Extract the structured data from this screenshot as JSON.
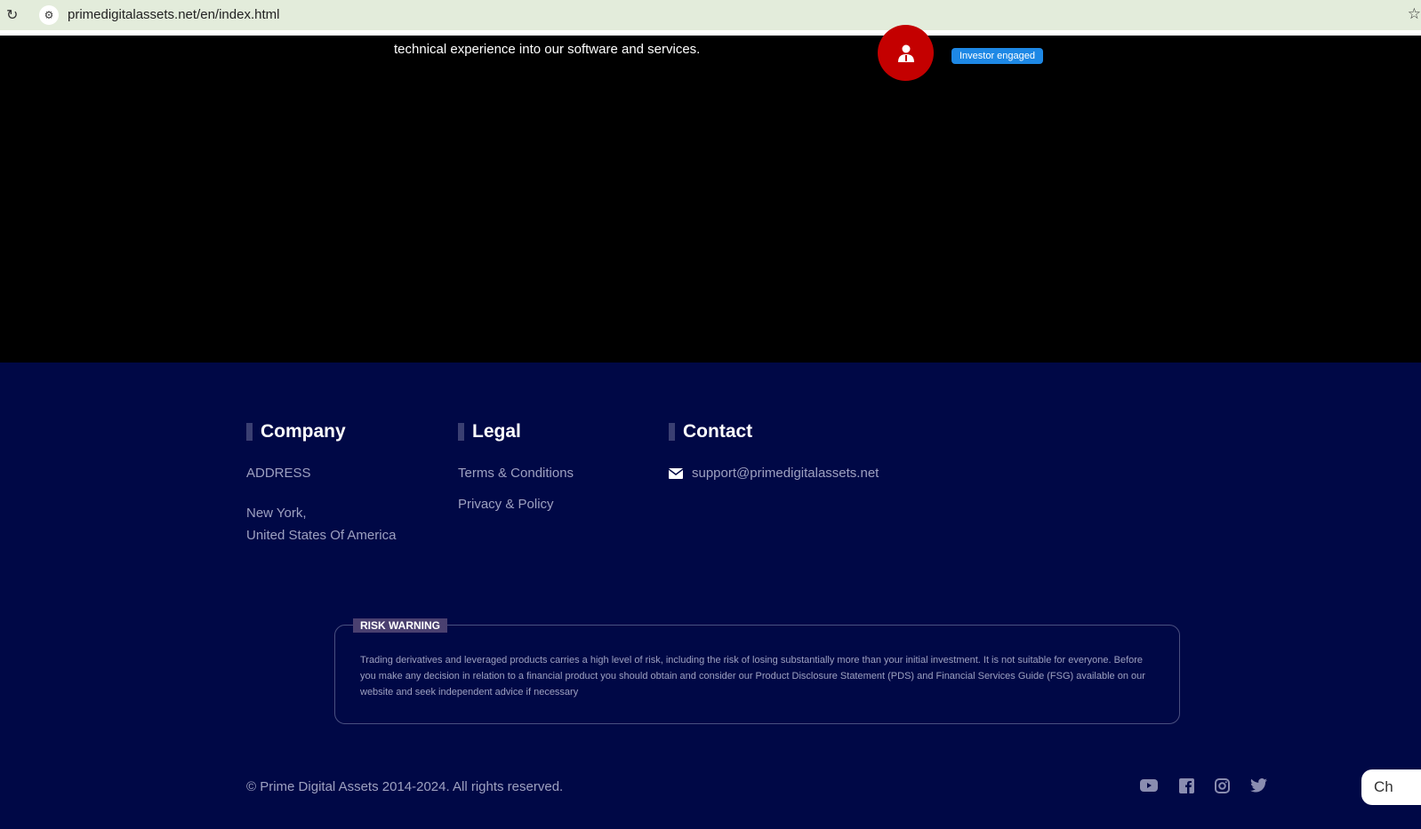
{
  "browser": {
    "url": "primedigitalassets.net/en/index.html"
  },
  "hero": {
    "text": "technical experience into our software and services.",
    "badge": "Investor engaged"
  },
  "footer": {
    "company": {
      "title": "Company",
      "address_label": "ADDRESS",
      "city": "New York,",
      "country": "United States Of America"
    },
    "legal": {
      "title": "Legal",
      "links": [
        "Terms & Conditions",
        "Privacy & Policy"
      ]
    },
    "contact": {
      "title": "Contact",
      "email": "support@primedigitalassets.net"
    },
    "risk": {
      "title": "RISK WARNING",
      "text": "Trading derivatives and leveraged products carries a high level of risk, including the risk of losing substantially more than your initial investment. It is not suitable for everyone. Before you make any decision in relation to a financial product you should obtain and consider our Product Disclosure Statement (PDS) and Financial Services Guide (FSG) available on our website and seek independent advice if necessary"
    },
    "copyright": "© Prime Digital Assets 2014-2024. All rights reserved.",
    "chat": "Ch"
  }
}
